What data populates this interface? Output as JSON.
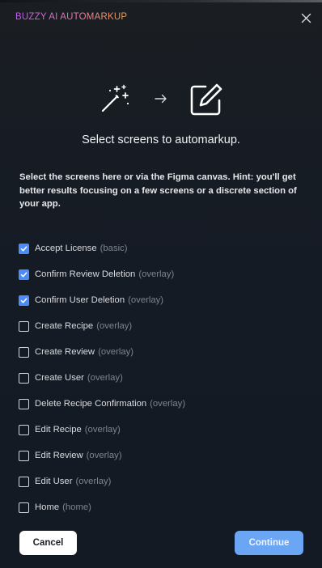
{
  "header": {
    "title": "BUZZY AI AUTOMARKUP",
    "close_icon": "close-icon"
  },
  "hero": {
    "icons": [
      "magic-wand-icon",
      "arrow-right-icon",
      "edit-icon"
    ]
  },
  "heading": "Select screens to automarkup.",
  "hint": "Select the screens here or via the Figma canvas. Hint: you'll get better results focusing on a few screens or a discrete section of your app.",
  "screens": [
    {
      "name": "Accept License",
      "type": "(basic)",
      "checked": true
    },
    {
      "name": "Confirm Review Deletion",
      "type": "(overlay)",
      "checked": true
    },
    {
      "name": "Confirm User Deletion",
      "type": "(overlay)",
      "checked": true
    },
    {
      "name": "Create Recipe",
      "type": "(overlay)",
      "checked": false
    },
    {
      "name": "Create Review",
      "type": "(overlay)",
      "checked": false
    },
    {
      "name": "Create User",
      "type": "(overlay)",
      "checked": false
    },
    {
      "name": "Delete Recipe Confirmation",
      "type": "(overlay)",
      "checked": false
    },
    {
      "name": "Edit Recipe",
      "type": "(overlay)",
      "checked": false
    },
    {
      "name": "Edit Review",
      "type": "(overlay)",
      "checked": false
    },
    {
      "name": "Edit User",
      "type": "(overlay)",
      "checked": false
    },
    {
      "name": "Home",
      "type": "(home)",
      "checked": false
    }
  ],
  "buttons": {
    "cancel": "Cancel",
    "continue": "Continue"
  },
  "colors": {
    "background": "#151b25",
    "accent": "#4a8df8",
    "continue_button": "#6aa6f4",
    "title_gradient": [
      "#c25cf0",
      "#e77ba8",
      "#f0a34f"
    ]
  }
}
